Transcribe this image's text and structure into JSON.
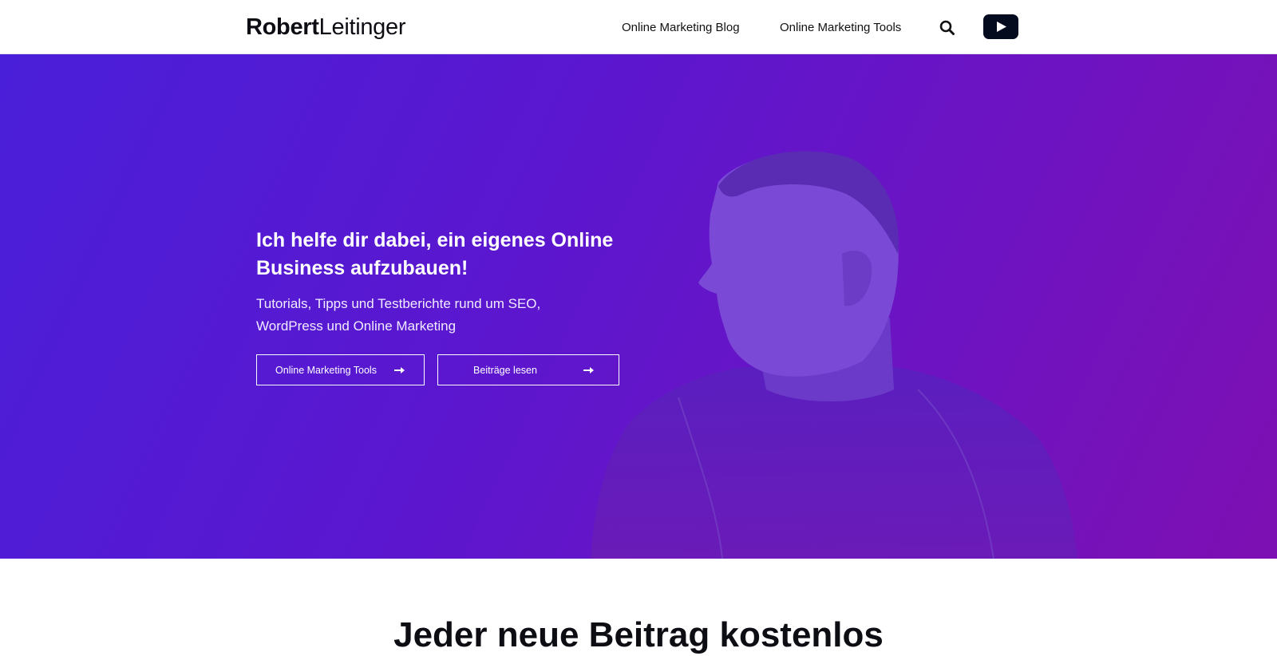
{
  "header": {
    "logo_first": "Robert",
    "logo_last": "Leitinger",
    "nav": [
      {
        "label": "Online Marketing Blog"
      },
      {
        "label": "Online Marketing Tools"
      }
    ]
  },
  "hero": {
    "title": "Ich helfe dir dabei, ein eigenes Online Business aufzubauen!",
    "subtitle": "Tutorials, Tipps und Testberichte rund um SEO, WordPress und Online Marketing",
    "buttons": [
      {
        "label": "Online Marketing Tools"
      },
      {
        "label": "Beiträge lesen"
      }
    ]
  },
  "section": {
    "heading": "Jeder neue Beitrag kostenlos"
  },
  "colors": {
    "gradient_start": "#4a1fd9",
    "gradient_end": "#7d10b2",
    "youtube_button": "#050b1f"
  },
  "icons": [
    "search-icon",
    "youtube-play-icon",
    "arrow-right-icon"
  ]
}
